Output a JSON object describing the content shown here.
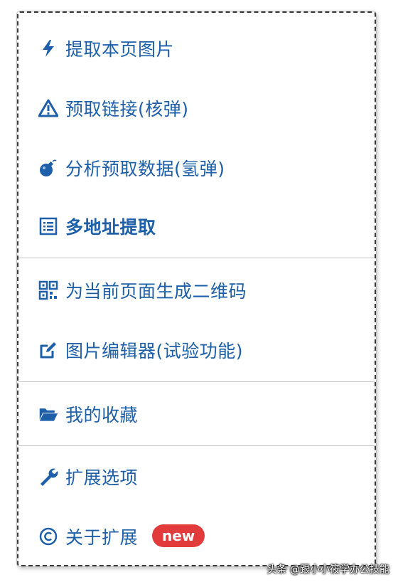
{
  "menu": {
    "items": [
      {
        "label": "提取本页图片",
        "icon": "lightning-icon"
      },
      {
        "label": "预取链接(核弹)",
        "icon": "warning-triangle-icon"
      },
      {
        "label": "分析预取数据(氢弹)",
        "icon": "bomb-icon"
      },
      {
        "label": "多地址提取",
        "icon": "list-icon"
      },
      {
        "label": "为当前页面生成二维码",
        "icon": "qrcode-icon"
      },
      {
        "label": "图片编辑器(试验功能)",
        "icon": "edit-icon"
      },
      {
        "label": "我的收藏",
        "icon": "folder-open-icon"
      },
      {
        "label": "扩展选项",
        "icon": "wrench-icon"
      },
      {
        "label": "关于扩展",
        "icon": "copyright-icon"
      }
    ],
    "new_badge": "new"
  },
  "watermark": "头条 @跟小小筱学办公技能",
  "colors": {
    "accent": "#1d5fa8",
    "badge": "#e23b3b",
    "divider": "#c8c8c8"
  }
}
